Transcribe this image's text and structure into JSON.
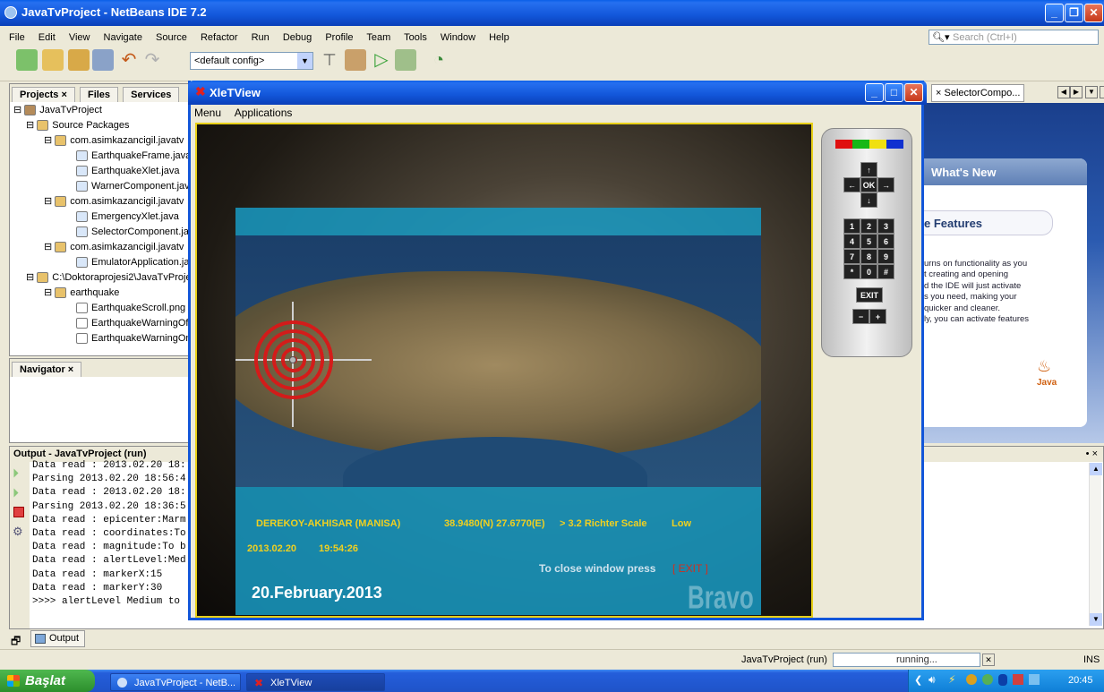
{
  "ide": {
    "title": "JavaTvProject - NetBeans IDE 7.2",
    "menu": [
      "File",
      "Edit",
      "View",
      "Navigate",
      "Source",
      "Refactor",
      "Run",
      "Debug",
      "Profile",
      "Team",
      "Tools",
      "Window",
      "Help"
    ],
    "search_placeholder": "Search (Ctrl+I)",
    "config": "<default config>"
  },
  "projects": {
    "tabs": [
      "Projects",
      "Files",
      "Services"
    ],
    "tree": [
      "JavaTvProject",
      "Source Packages",
      "com.asimkazancigil.javatv",
      "EarthquakeFrame.java",
      "EarthquakeXlet.java",
      "WarnerComponent.java",
      "com.asimkazancigil.javatv",
      "EmergencyXlet.java",
      "SelectorComponent.java",
      "com.asimkazancigil.javatv",
      "EmulatorApplication.java",
      "C:\\Doktoraprojesi2\\JavaTvProject",
      "earthquake",
      "EarthquakeScroll.png",
      "EarthquakeWarningOff",
      "EarthquakeWarningOn"
    ]
  },
  "navigator": {
    "title": "Navigator"
  },
  "output": {
    "title": "Output - JavaTvProject (run)",
    "lines": [
      "Data read : 2013.02.20 18:",
      "Parsing 2013.02.20 18:56:4",
      "Data read : 2013.02.20 18:",
      "Parsing 2013.02.20 18:36:5",
      "Data read : epicenter:Marm",
      "Data read : coordinates:To",
      "Data read : magnitude:To b",
      "Data read : alertLevel:Med",
      "Data read : markerX:15",
      "Data read : markerY:30",
      ">>>> alertLevel Medium to"
    ],
    "tab": "Output"
  },
  "editor_tab": "SelectorCompo...",
  "whats_new": {
    "heading": "What's New",
    "features": "e Features",
    "body": [
      "urns on functionality as you",
      "t creating and opening",
      "d the IDE will just activate",
      "s you need, making your",
      " quicker and cleaner.",
      "ly, you can activate features"
    ],
    "java_logo": "Java"
  },
  "xlet": {
    "title": "XleTView",
    "menu": [
      "Menu",
      "Applications"
    ],
    "location": "DEREKOY-AKHISAR (MANISA)",
    "coordinates": "38.9480(N)  27.6770(E)",
    "magnitude": "> 3.2 Richter Scale",
    "level": "Low",
    "date": "2013.02.20",
    "time": "19:54:26",
    "close_hint": "To close window press",
    "exit_label": "[ EXIT ]",
    "big_date": "20.February.2013",
    "watermark": "Bravo"
  },
  "remote": {
    "arrows": {
      "up": "↑",
      "left": "←",
      "ok": "OK",
      "right": "→",
      "down": "↓"
    },
    "keys": [
      "1",
      "2",
      "3",
      "4",
      "5",
      "6",
      "7",
      "8",
      "9",
      "*",
      "0",
      "#"
    ],
    "exit": "EXIT",
    "minus": "−",
    "plus": "+",
    "color_keys": [
      "#e01010",
      "#18b818",
      "#f0e010",
      "#1030d0"
    ]
  },
  "status": {
    "run_label": "JavaTvProject (run)",
    "progress_text": "running...",
    "ins": "INS"
  },
  "taskbar": {
    "start": "Başlat",
    "items": [
      "JavaTvProject - NetB...",
      "XleTView"
    ],
    "clock": "20:45"
  },
  "colors": {
    "xp_blue": "#245edb",
    "tv_panel": "#1e8fb4",
    "tv_text_yellow": "#f0d020",
    "exit_red": "#d03020",
    "target_red": "#d81818"
  }
}
